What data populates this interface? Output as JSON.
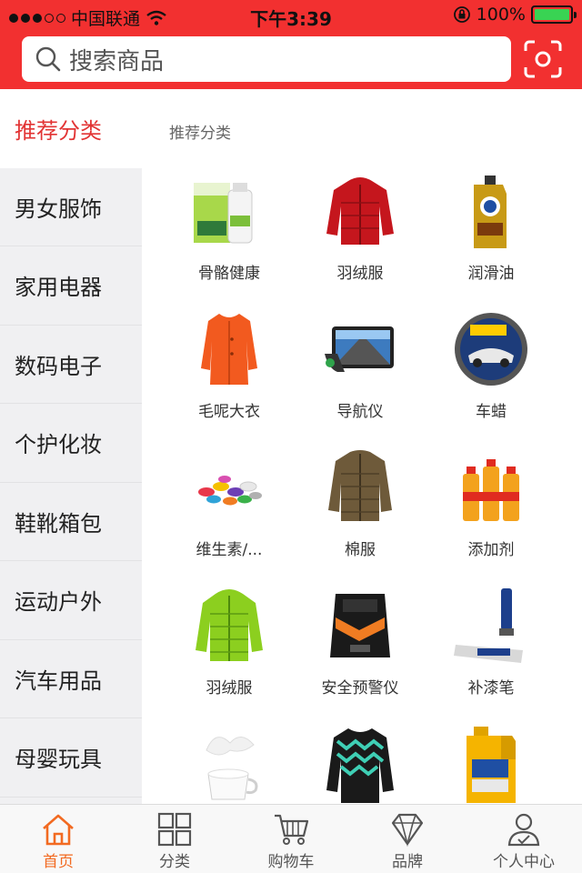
{
  "status": {
    "carrier": "中国联通",
    "time": "下午3:39",
    "battery": "100%",
    "battery_level": 1.0
  },
  "search": {
    "placeholder": "搜索商品"
  },
  "sidebar": {
    "items": [
      {
        "label": "推荐分类",
        "active": true
      },
      {
        "label": "男女服饰"
      },
      {
        "label": "家用电器"
      },
      {
        "label": "数码电子"
      },
      {
        "label": "个护化妆"
      },
      {
        "label": "鞋靴箱包"
      },
      {
        "label": "运动户外"
      },
      {
        "label": "汽车用品"
      },
      {
        "label": "母婴玩具"
      }
    ]
  },
  "content": {
    "section_title": "推荐分类",
    "products": [
      {
        "label": "骨骼健康",
        "icon": "supplement-bottle-icon"
      },
      {
        "label": "羽绒服",
        "icon": "red-down-jacket-icon"
      },
      {
        "label": "润滑油",
        "icon": "motor-oil-icon"
      },
      {
        "label": "毛呢大衣",
        "icon": "orange-coat-icon"
      },
      {
        "label": "导航仪",
        "icon": "gps-navigator-icon"
      },
      {
        "label": "车蜡",
        "icon": "car-wax-icon"
      },
      {
        "label": "维生素/...",
        "icon": "vitamin-pills-icon"
      },
      {
        "label": "棉服",
        "icon": "brown-padded-jacket-icon"
      },
      {
        "label": "添加剂",
        "icon": "fuel-additive-icon"
      },
      {
        "label": "羽绒服",
        "icon": "green-down-jacket-icon"
      },
      {
        "label": "安全预警仪",
        "icon": "radar-detector-icon"
      },
      {
        "label": "补漆笔",
        "icon": "paint-pen-icon"
      },
      {
        "label": "",
        "icon": "milk-cup-icon"
      },
      {
        "label": "",
        "icon": "knit-sweater-icon"
      },
      {
        "label": "",
        "icon": "oil-jug-icon"
      }
    ]
  },
  "tabbar": {
    "items": [
      {
        "label": "首页",
        "icon": "home-icon",
        "active": true
      },
      {
        "label": "分类",
        "icon": "grid-icon"
      },
      {
        "label": "购物车",
        "icon": "cart-icon"
      },
      {
        "label": "品牌",
        "icon": "diamond-icon"
      },
      {
        "label": "个人中心",
        "icon": "user-icon"
      }
    ]
  },
  "colors": {
    "brand_red": "#f23030",
    "active_tab": "#f26a21",
    "active_category": "#e23434"
  }
}
